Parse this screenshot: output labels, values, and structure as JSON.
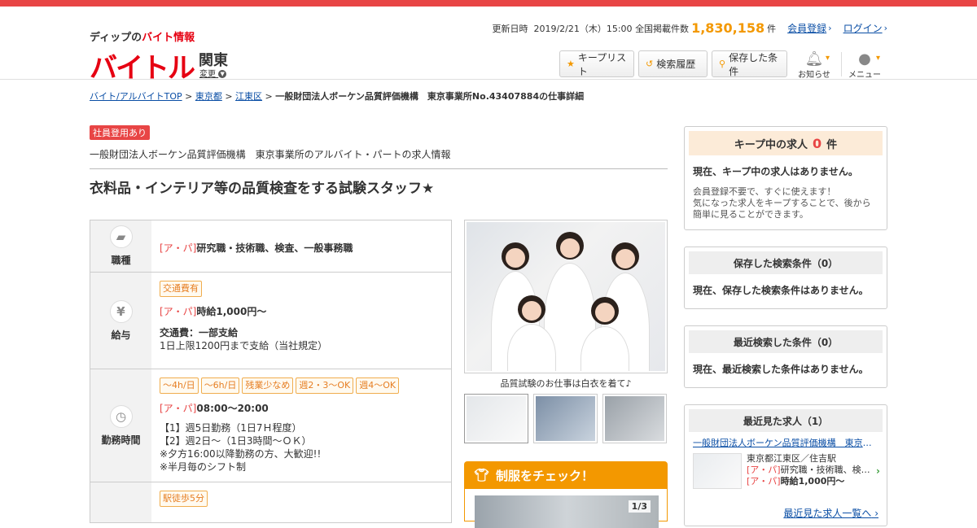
{
  "header": {
    "logo_sub_prefix": "ディップの",
    "logo_sub_highlight": "バイト情報",
    "logo_main": "バイトル",
    "region": "関東",
    "region_change": "変更",
    "updated_label": "更新日時",
    "updated_value": "2019/2/21（木）15:00",
    "count_label": "全国掲載件数",
    "count_value": "1,830,158",
    "count_unit": "件",
    "register": "会員登録",
    "login": "ログイン",
    "buttons": {
      "keep_list": "キープリスト",
      "search_history": "検索履歴",
      "saved_conditions": "保存した条件"
    },
    "notice": "お知らせ",
    "menu": "メニュー"
  },
  "breadcrumb": {
    "top": "バイト/アルバイトTOP",
    "pref": "東京都",
    "ward": "江東区",
    "current": "一般財団法人ボーケン品質評価機構　東京事業所No.43407884の仕事詳細",
    "sep": ">"
  },
  "job": {
    "employee_tag": "社員登用あり",
    "company_line": "一般財団法人ボーケン品質評価機構　東京事業所のアルバイト・パートの求人情報",
    "title": "衣料品・インテリア等の品質検査をする試験スタッフ★",
    "ap": "[ア・パ]",
    "rows": {
      "occupation": {
        "label": "職種",
        "value": "研究職・技術職、検査、一般事務職"
      },
      "salary": {
        "label": "給与",
        "tags": [
          "交通費有"
        ],
        "value": "時給1,000円～",
        "transport_title": "交通費：一部支給",
        "transport_detail": "1日上限1200円まで支給（当社規定）"
      },
      "hours": {
        "label": "勤務時間",
        "tags": [
          "～4h/日",
          "～6h/日",
          "残業少なめ",
          "週2・3〜OK",
          "週4〜OK"
        ],
        "value": "08:00～20:00",
        "lines": [
          "【1】週5日勤務（1日7Ｈ程度）",
          "【2】週2日～（1日3時間～ＯＫ）",
          "※夕方16:00以降勤務の方、大歓迎!!",
          "※半月毎のシフト制"
        ]
      },
      "access": {
        "tags": [
          "駅徒歩5分"
        ]
      }
    },
    "photo_caption": "品質試験のお仕事は白衣を着て♪",
    "uniform_title": "制服をチェック！",
    "uniform_pager": "1/3"
  },
  "sidebar": {
    "keep": {
      "title": "キープ中の求人",
      "count": "0",
      "unit": "件",
      "empty": "現在、キープ中の求人はありません。",
      "desc1": "会員登録不要で、すぐに使えます！",
      "desc2": "気になった求人をキープすることで、後から",
      "desc3": "簡単に見ることができます。"
    },
    "saved": {
      "title": "保存した検索条件（0）",
      "empty": "現在、保存した検索条件はありません。"
    },
    "recent_search": {
      "title": "最近検索した条件（0）",
      "empty": "現在、最近検索した条件はありません。"
    },
    "recent_view": {
      "title": "最近見た求人（1）",
      "link": "一般財団法人ボーケン品質評価機構　東京事業所",
      "place": "東京都江東区／住吉駅",
      "occupation": "研究職・技術職、検…",
      "wage": "時給1,000円～",
      "all": "最近見た求人一覧へ"
    }
  }
}
